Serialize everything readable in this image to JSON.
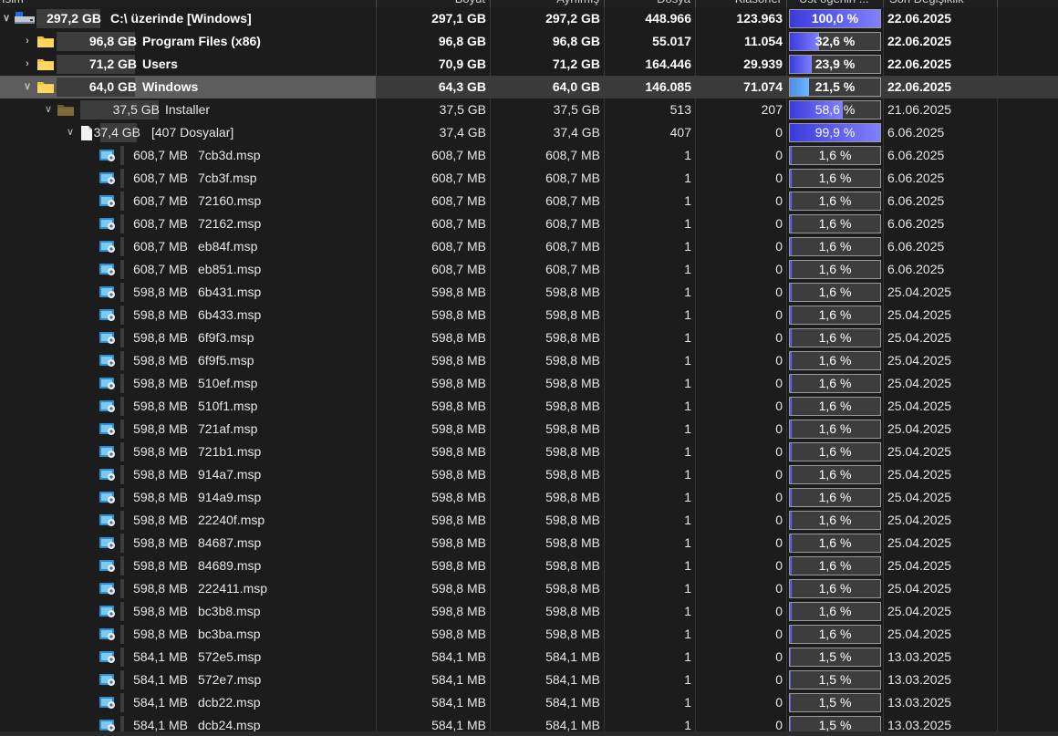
{
  "columns": [
    "İsim",
    "Boyut",
    "Ayrılmış",
    "Dosya",
    "Klasörler",
    "Üst öğenin ...",
    "Son Değişiklik"
  ],
  "rows": [
    {
      "level": 0,
      "chev": "down",
      "icon": "drive",
      "bold": true,
      "sel": false,
      "size": "297,2 GB",
      "name": "C:\\  üzerinde  [Windows]",
      "boyut": "297,1 GB",
      "ayrilmis": "297,2 GB",
      "dosya": "448.966",
      "klasor": "123.963",
      "pct": "100,0 %",
      "pctv": 100.0,
      "date": "22.06.2025"
    },
    {
      "level": 1,
      "chev": "right",
      "icon": "folder",
      "bold": true,
      "sel": false,
      "size": "96,8 GB",
      "name": "Program Files (x86)",
      "boyut": "96,8 GB",
      "ayrilmis": "96,8 GB",
      "dosya": "55.017",
      "klasor": "11.054",
      "pct": "32,6 %",
      "pctv": 32.6,
      "date": "22.06.2025"
    },
    {
      "level": 1,
      "chev": "right",
      "icon": "folder",
      "bold": true,
      "sel": false,
      "size": "71,2 GB",
      "name": "Users",
      "boyut": "70,9 GB",
      "ayrilmis": "71,2 GB",
      "dosya": "164.446",
      "klasor": "29.939",
      "pct": "23,9 %",
      "pctv": 23.9,
      "date": "22.06.2025"
    },
    {
      "level": 1,
      "chev": "down",
      "icon": "folder",
      "bold": true,
      "sel": true,
      "size": "64,0 GB",
      "name": "Windows",
      "boyut": "64,3 GB",
      "ayrilmis": "64,0 GB",
      "dosya": "146.085",
      "klasor": "71.074",
      "pct": "21,5 %",
      "pctv": 21.5,
      "date": "22.06.2025"
    },
    {
      "level": 2,
      "chev": "down",
      "icon": "folder-dark",
      "bold": false,
      "sel": false,
      "size": "37,5 GB",
      "name": "Installer",
      "boyut": "37,5 GB",
      "ayrilmis": "37,5 GB",
      "dosya": "513",
      "klasor": "207",
      "pct": "58,6 %",
      "pctv": 58.6,
      "date": "21.06.2025"
    },
    {
      "level": 3,
      "chev": "down",
      "icon": "file",
      "bold": false,
      "sel": false,
      "size": "37,4 GB",
      "name": "[407 Dosyalar]",
      "boyut": "37,4 GB",
      "ayrilmis": "37,4 GB",
      "dosya": "407",
      "klasor": "0",
      "pct": "99,9 %",
      "pctv": 99.9,
      "date": "6.06.2025"
    },
    {
      "level": 4,
      "chev": "",
      "icon": "msp",
      "bold": false,
      "sel": false,
      "size": "608,7 MB",
      "name": "7cb3d.msp",
      "boyut": "608,7 MB",
      "ayrilmis": "608,7 MB",
      "dosya": "1",
      "klasor": "0",
      "pct": "1,6 %",
      "pctv": 1.6,
      "date": "6.06.2025"
    },
    {
      "level": 4,
      "chev": "",
      "icon": "msp",
      "bold": false,
      "sel": false,
      "size": "608,7 MB",
      "name": "7cb3f.msp",
      "boyut": "608,7 MB",
      "ayrilmis": "608,7 MB",
      "dosya": "1",
      "klasor": "0",
      "pct": "1,6 %",
      "pctv": 1.6,
      "date": "6.06.2025"
    },
    {
      "level": 4,
      "chev": "",
      "icon": "msp",
      "bold": false,
      "sel": false,
      "size": "608,7 MB",
      "name": "72160.msp",
      "boyut": "608,7 MB",
      "ayrilmis": "608,7 MB",
      "dosya": "1",
      "klasor": "0",
      "pct": "1,6 %",
      "pctv": 1.6,
      "date": "6.06.2025"
    },
    {
      "level": 4,
      "chev": "",
      "icon": "msp",
      "bold": false,
      "sel": false,
      "size": "608,7 MB",
      "name": "72162.msp",
      "boyut": "608,7 MB",
      "ayrilmis": "608,7 MB",
      "dosya": "1",
      "klasor": "0",
      "pct": "1,6 %",
      "pctv": 1.6,
      "date": "6.06.2025"
    },
    {
      "level": 4,
      "chev": "",
      "icon": "msp",
      "bold": false,
      "sel": false,
      "size": "608,7 MB",
      "name": "eb84f.msp",
      "boyut": "608,7 MB",
      "ayrilmis": "608,7 MB",
      "dosya": "1",
      "klasor": "0",
      "pct": "1,6 %",
      "pctv": 1.6,
      "date": "6.06.2025"
    },
    {
      "level": 4,
      "chev": "",
      "icon": "msp",
      "bold": false,
      "sel": false,
      "size": "608,7 MB",
      "name": "eb851.msp",
      "boyut": "608,7 MB",
      "ayrilmis": "608,7 MB",
      "dosya": "1",
      "klasor": "0",
      "pct": "1,6 %",
      "pctv": 1.6,
      "date": "6.06.2025"
    },
    {
      "level": 4,
      "chev": "",
      "icon": "msp",
      "bold": false,
      "sel": false,
      "size": "598,8 MB",
      "name": "6b431.msp",
      "boyut": "598,8 MB",
      "ayrilmis": "598,8 MB",
      "dosya": "1",
      "klasor": "0",
      "pct": "1,6 %",
      "pctv": 1.6,
      "date": "25.04.2025"
    },
    {
      "level": 4,
      "chev": "",
      "icon": "msp",
      "bold": false,
      "sel": false,
      "size": "598,8 MB",
      "name": "6b433.msp",
      "boyut": "598,8 MB",
      "ayrilmis": "598,8 MB",
      "dosya": "1",
      "klasor": "0",
      "pct": "1,6 %",
      "pctv": 1.6,
      "date": "25.04.2025"
    },
    {
      "level": 4,
      "chev": "",
      "icon": "msp",
      "bold": false,
      "sel": false,
      "size": "598,8 MB",
      "name": "6f9f3.msp",
      "boyut": "598,8 MB",
      "ayrilmis": "598,8 MB",
      "dosya": "1",
      "klasor": "0",
      "pct": "1,6 %",
      "pctv": 1.6,
      "date": "25.04.2025"
    },
    {
      "level": 4,
      "chev": "",
      "icon": "msp",
      "bold": false,
      "sel": false,
      "size": "598,8 MB",
      "name": "6f9f5.msp",
      "boyut": "598,8 MB",
      "ayrilmis": "598,8 MB",
      "dosya": "1",
      "klasor": "0",
      "pct": "1,6 %",
      "pctv": 1.6,
      "date": "25.04.2025"
    },
    {
      "level": 4,
      "chev": "",
      "icon": "msp",
      "bold": false,
      "sel": false,
      "size": "598,8 MB",
      "name": "510ef.msp",
      "boyut": "598,8 MB",
      "ayrilmis": "598,8 MB",
      "dosya": "1",
      "klasor": "0",
      "pct": "1,6 %",
      "pctv": 1.6,
      "date": "25.04.2025"
    },
    {
      "level": 4,
      "chev": "",
      "icon": "msp",
      "bold": false,
      "sel": false,
      "size": "598,8 MB",
      "name": "510f1.msp",
      "boyut": "598,8 MB",
      "ayrilmis": "598,8 MB",
      "dosya": "1",
      "klasor": "0",
      "pct": "1,6 %",
      "pctv": 1.6,
      "date": "25.04.2025"
    },
    {
      "level": 4,
      "chev": "",
      "icon": "msp",
      "bold": false,
      "sel": false,
      "size": "598,8 MB",
      "name": "721af.msp",
      "boyut": "598,8 MB",
      "ayrilmis": "598,8 MB",
      "dosya": "1",
      "klasor": "0",
      "pct": "1,6 %",
      "pctv": 1.6,
      "date": "25.04.2025"
    },
    {
      "level": 4,
      "chev": "",
      "icon": "msp",
      "bold": false,
      "sel": false,
      "size": "598,8 MB",
      "name": "721b1.msp",
      "boyut": "598,8 MB",
      "ayrilmis": "598,8 MB",
      "dosya": "1",
      "klasor": "0",
      "pct": "1,6 %",
      "pctv": 1.6,
      "date": "25.04.2025"
    },
    {
      "level": 4,
      "chev": "",
      "icon": "msp",
      "bold": false,
      "sel": false,
      "size": "598,8 MB",
      "name": "914a7.msp",
      "boyut": "598,8 MB",
      "ayrilmis": "598,8 MB",
      "dosya": "1",
      "klasor": "0",
      "pct": "1,6 %",
      "pctv": 1.6,
      "date": "25.04.2025"
    },
    {
      "level": 4,
      "chev": "",
      "icon": "msp",
      "bold": false,
      "sel": false,
      "size": "598,8 MB",
      "name": "914a9.msp",
      "boyut": "598,8 MB",
      "ayrilmis": "598,8 MB",
      "dosya": "1",
      "klasor": "0",
      "pct": "1,6 %",
      "pctv": 1.6,
      "date": "25.04.2025"
    },
    {
      "level": 4,
      "chev": "",
      "icon": "msp",
      "bold": false,
      "sel": false,
      "size": "598,8 MB",
      "name": "22240f.msp",
      "boyut": "598,8 MB",
      "ayrilmis": "598,8 MB",
      "dosya": "1",
      "klasor": "0",
      "pct": "1,6 %",
      "pctv": 1.6,
      "date": "25.04.2025"
    },
    {
      "level": 4,
      "chev": "",
      "icon": "msp",
      "bold": false,
      "sel": false,
      "size": "598,8 MB",
      "name": "84687.msp",
      "boyut": "598,8 MB",
      "ayrilmis": "598,8 MB",
      "dosya": "1",
      "klasor": "0",
      "pct": "1,6 %",
      "pctv": 1.6,
      "date": "25.04.2025"
    },
    {
      "level": 4,
      "chev": "",
      "icon": "msp",
      "bold": false,
      "sel": false,
      "size": "598,8 MB",
      "name": "84689.msp",
      "boyut": "598,8 MB",
      "ayrilmis": "598,8 MB",
      "dosya": "1",
      "klasor": "0",
      "pct": "1,6 %",
      "pctv": 1.6,
      "date": "25.04.2025"
    },
    {
      "level": 4,
      "chev": "",
      "icon": "msp",
      "bold": false,
      "sel": false,
      "size": "598,8 MB",
      "name": "222411.msp",
      "boyut": "598,8 MB",
      "ayrilmis": "598,8 MB",
      "dosya": "1",
      "klasor": "0",
      "pct": "1,6 %",
      "pctv": 1.6,
      "date": "25.04.2025"
    },
    {
      "level": 4,
      "chev": "",
      "icon": "msp",
      "bold": false,
      "sel": false,
      "size": "598,8 MB",
      "name": "bc3b8.msp",
      "boyut": "598,8 MB",
      "ayrilmis": "598,8 MB",
      "dosya": "1",
      "klasor": "0",
      "pct": "1,6 %",
      "pctv": 1.6,
      "date": "25.04.2025"
    },
    {
      "level": 4,
      "chev": "",
      "icon": "msp",
      "bold": false,
      "sel": false,
      "size": "598,8 MB",
      "name": "bc3ba.msp",
      "boyut": "598,8 MB",
      "ayrilmis": "598,8 MB",
      "dosya": "1",
      "klasor": "0",
      "pct": "1,6 %",
      "pctv": 1.6,
      "date": "25.04.2025"
    },
    {
      "level": 4,
      "chev": "",
      "icon": "msp",
      "bold": false,
      "sel": false,
      "size": "584,1 MB",
      "name": "572e5.msp",
      "boyut": "584,1 MB",
      "ayrilmis": "584,1 MB",
      "dosya": "1",
      "klasor": "0",
      "pct": "1,5 %",
      "pctv": 1.5,
      "date": "13.03.2025"
    },
    {
      "level": 4,
      "chev": "",
      "icon": "msp",
      "bold": false,
      "sel": false,
      "size": "584,1 MB",
      "name": "572e7.msp",
      "boyut": "584,1 MB",
      "ayrilmis": "584,1 MB",
      "dosya": "1",
      "klasor": "0",
      "pct": "1,5 %",
      "pctv": 1.5,
      "date": "13.03.2025"
    },
    {
      "level": 4,
      "chev": "",
      "icon": "msp",
      "bold": false,
      "sel": false,
      "size": "584,1 MB",
      "name": "dcb22.msp",
      "boyut": "584,1 MB",
      "ayrilmis": "584,1 MB",
      "dosya": "1",
      "klasor": "0",
      "pct": "1,5 %",
      "pctv": 1.5,
      "date": "13.03.2025"
    },
    {
      "level": 4,
      "chev": "",
      "icon": "msp",
      "bold": false,
      "sel": false,
      "size": "584,1 MB",
      "name": "dcb24.msp",
      "boyut": "584,1 MB",
      "ayrilmis": "584,1 MB",
      "dosya": "1",
      "klasor": "0",
      "pct": "1,5 %",
      "pctv": 1.5,
      "date": "13.03.2025"
    }
  ]
}
